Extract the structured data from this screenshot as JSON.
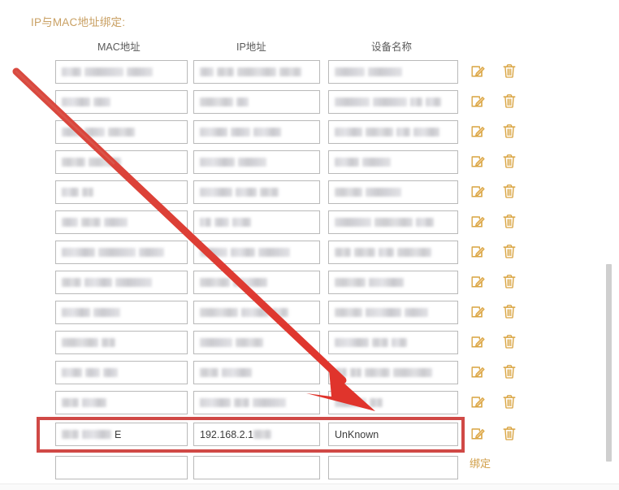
{
  "page": {
    "title": "IP与MAC地址绑定:",
    "title_color": "#c9a063",
    "background": "#ffffff"
  },
  "table": {
    "headers": [
      "MAC地址",
      "IP地址",
      "设备名称"
    ],
    "row_action_icons": [
      "edit-icon",
      "delete-icon"
    ],
    "icon_color": "#d9a441",
    "rows": [
      {
        "mac": "",
        "ip": "",
        "device": "",
        "redacted": true
      },
      {
        "mac": "",
        "ip": "",
        "device": "",
        "redacted": true
      },
      {
        "mac": "",
        "ip": "",
        "device": "",
        "redacted": true
      },
      {
        "mac": "",
        "ip": "",
        "device": "",
        "redacted": true
      },
      {
        "mac": "",
        "ip": "",
        "device": "",
        "redacted": true
      },
      {
        "mac": "",
        "ip": "",
        "device": "",
        "redacted": true
      },
      {
        "mac": "",
        "ip": "",
        "device": "",
        "redacted": true
      },
      {
        "mac": "",
        "ip": "",
        "device": "",
        "redacted": true
      },
      {
        "mac": "",
        "ip": "",
        "device": "",
        "redacted": true
      },
      {
        "mac": "",
        "ip": "",
        "device": "",
        "redacted": true
      },
      {
        "mac": "",
        "ip": "",
        "device": "",
        "redacted": true
      },
      {
        "mac": "",
        "ip": "",
        "device": "",
        "redacted": true
      }
    ],
    "highlighted_row": {
      "mac": "E",
      "ip": "192.168.2.1",
      "device": "UnKnown",
      "redacted": true
    },
    "empty_row": {
      "mac": "",
      "ip": "",
      "device": ""
    }
  },
  "actions": {
    "bind_label": "绑定",
    "bind_color": "#d4a657"
  },
  "annotations": {
    "highlight_box_color": "#c9302c",
    "arrow_color": "#e03a32",
    "arrow_start": "20,88",
    "arrow_end": "460,505"
  },
  "scrollbar": {
    "thumb_color": "#cfcfcf"
  }
}
